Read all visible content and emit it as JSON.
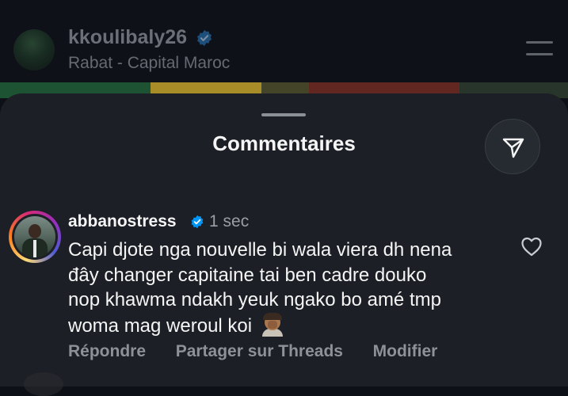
{
  "post": {
    "username": "kkoulibaly26",
    "location": "Rabat - Capital Maroc",
    "verified_icon": "verified-badge-icon",
    "menu_icon": "menu-icon"
  },
  "sheet": {
    "title": "Commentaires",
    "share_icon": "send-icon"
  },
  "comment": {
    "username": "abbanostress",
    "time": "1 sec",
    "lines": [
      "Capi djote nga nouvelle bi wala viera dh nena",
      "đây changer capitaine tai ben cadre douko",
      "nop khawma ndakh yeuk ngako bo amé tmp",
      "woma mag weroul koi"
    ],
    "emoji": "person-facepalming-emoji",
    "actions": {
      "reply": "Répondre",
      "share_threads": "Partager sur Threads",
      "edit": "Modifier"
    },
    "like_icon": "heart-icon"
  },
  "colors": {
    "background": "#0d1016",
    "sheet": "#1c1f25",
    "verified": "#0095f6",
    "muted_text": "#8e9298"
  }
}
